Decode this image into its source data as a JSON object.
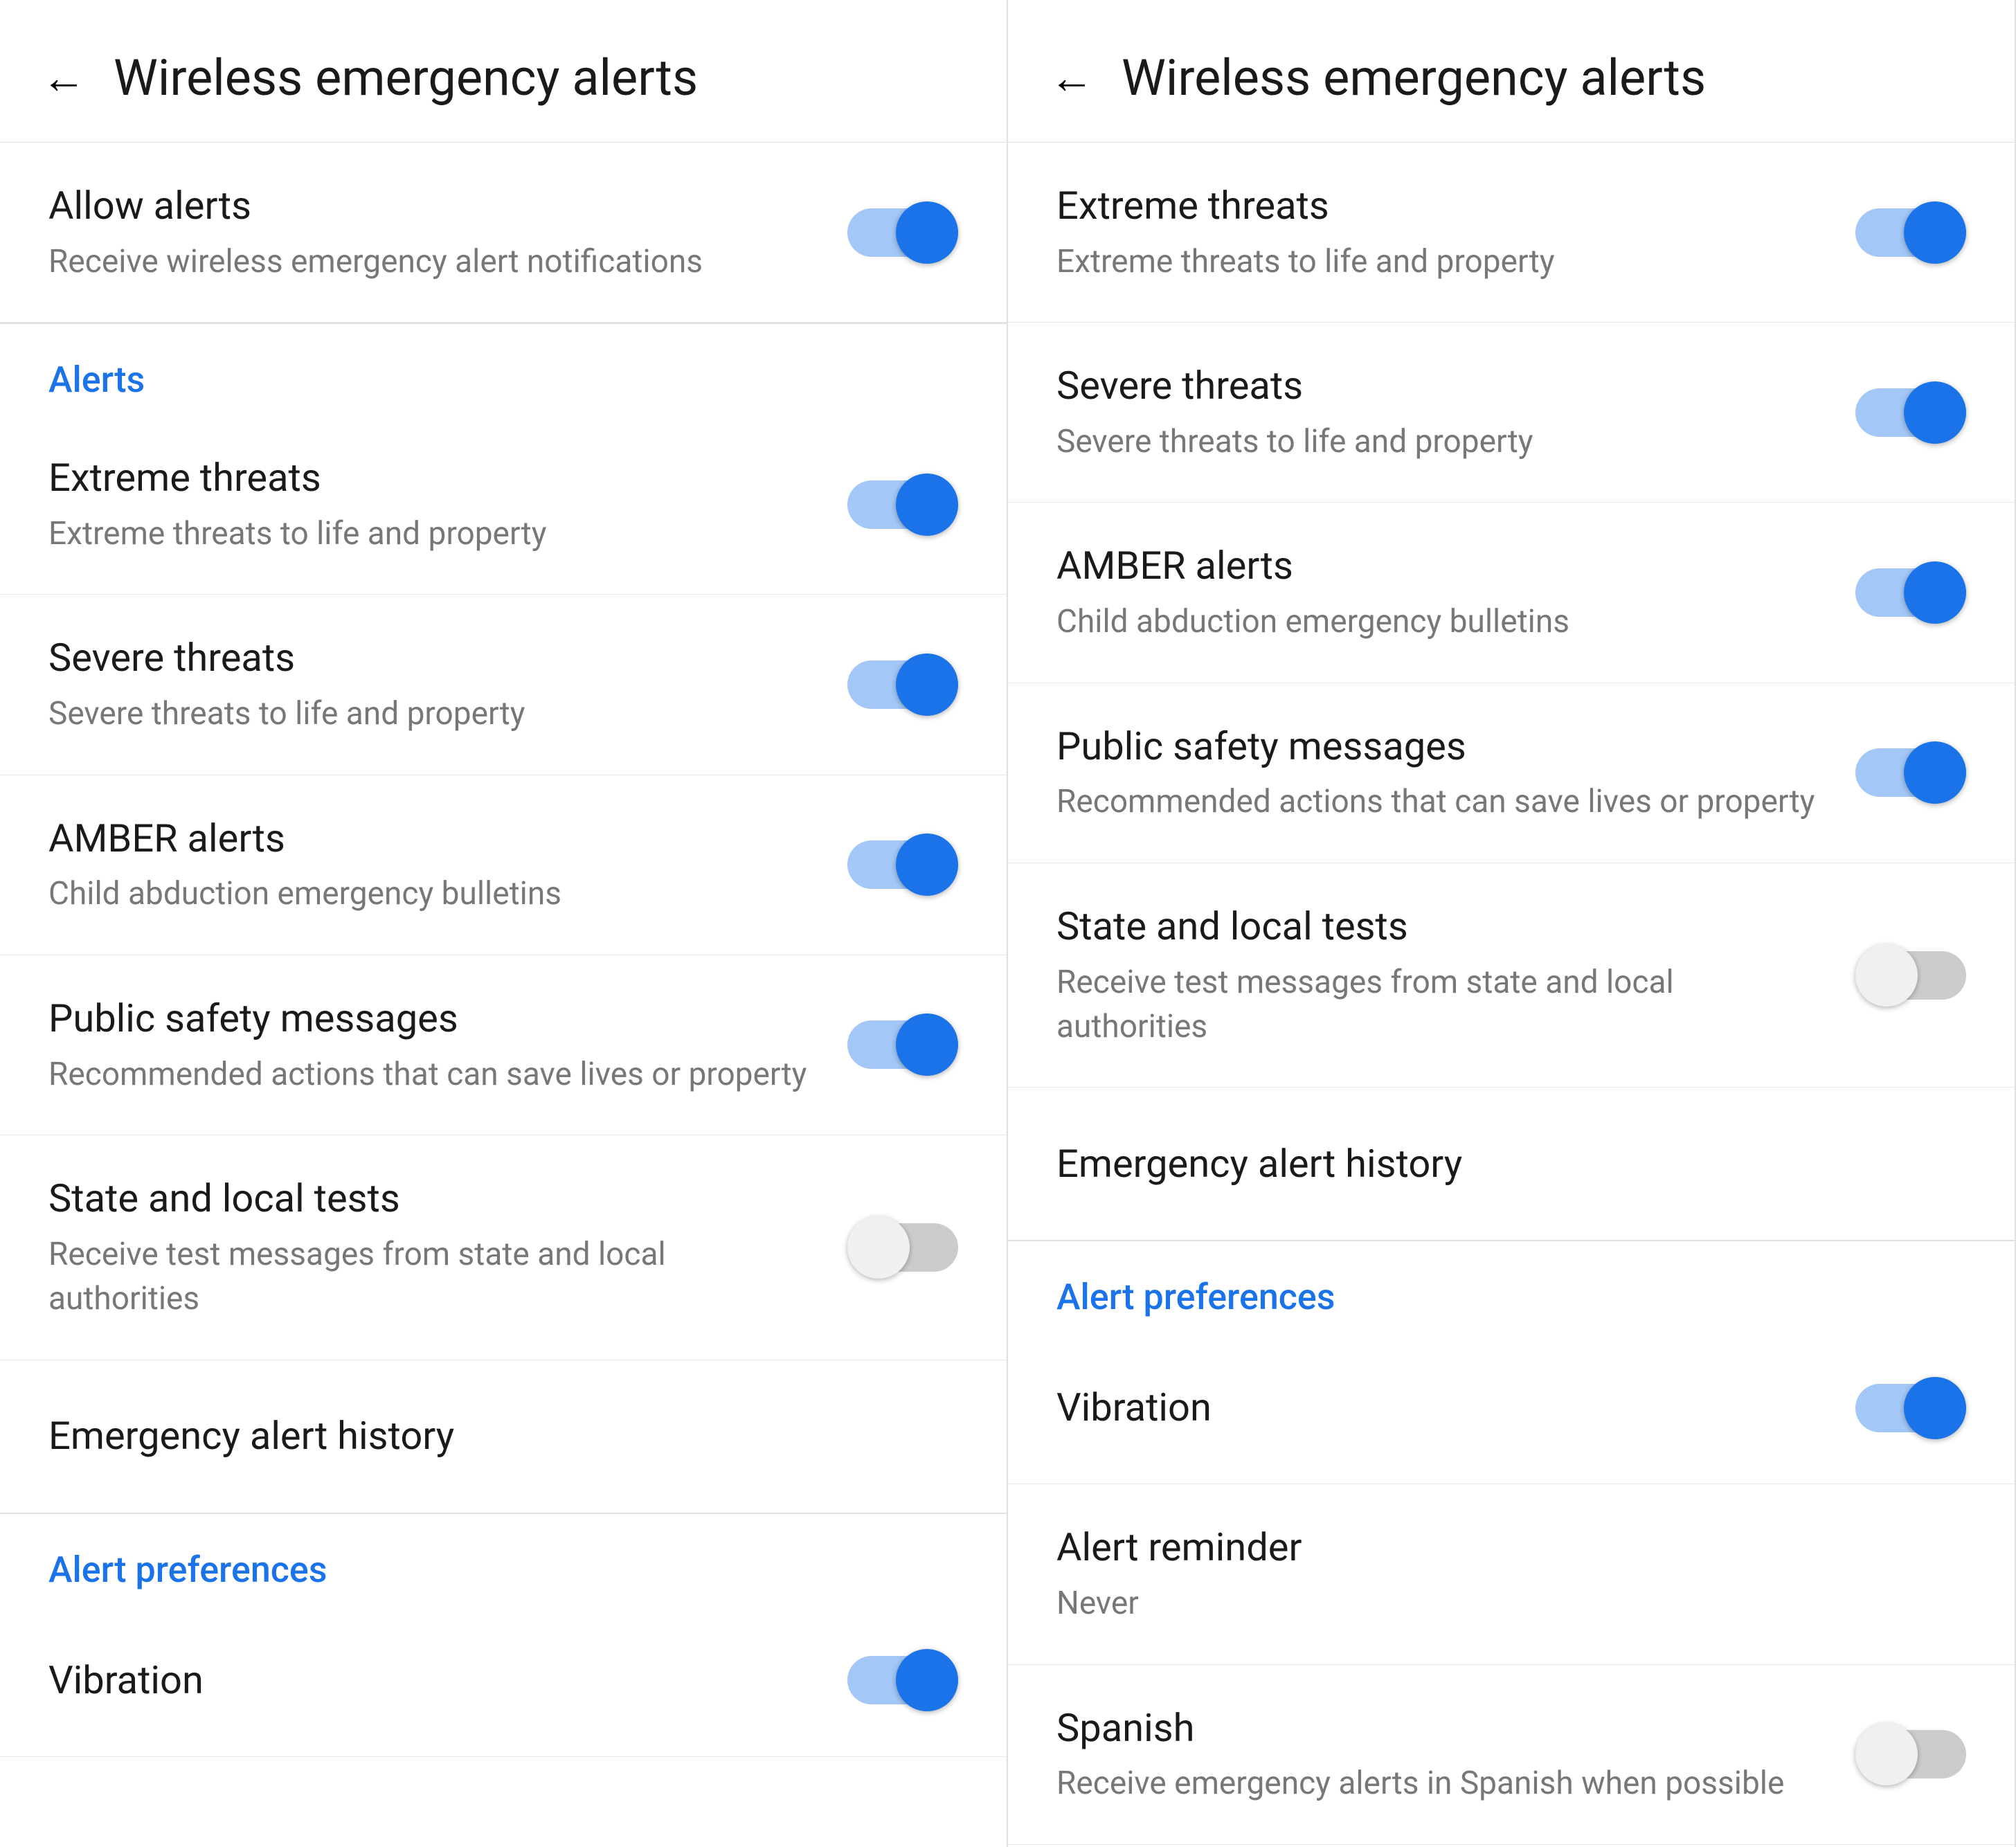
{
  "panel1": {
    "header": {
      "back_label": "←",
      "title": "Wireless emergency alerts"
    },
    "items": [
      {
        "id": "allow-alerts",
        "title": "Allow alerts",
        "subtitle": "Receive wireless emergency alert notifications",
        "toggle": true,
        "has_toggle": true
      }
    ],
    "alerts_section_label": "Alerts",
    "alert_items": [
      {
        "id": "extreme-threats",
        "title": "Extreme threats",
        "subtitle": "Extreme threats to life and property",
        "toggle": true,
        "has_toggle": true
      },
      {
        "id": "severe-threats",
        "title": "Severe threats",
        "subtitle": "Severe threats to life and property",
        "toggle": true,
        "has_toggle": true
      },
      {
        "id": "amber-alerts",
        "title": "AMBER alerts",
        "subtitle": "Child abduction emergency bulletins",
        "toggle": true,
        "has_toggle": true
      },
      {
        "id": "public-safety",
        "title": "Public safety messages",
        "subtitle": "Recommended actions that can save lives or property",
        "toggle": true,
        "has_toggle": true
      },
      {
        "id": "state-local-tests",
        "title": "State and local tests",
        "subtitle": "Receive test messages from state and local authorities",
        "toggle": false,
        "has_toggle": true
      },
      {
        "id": "emergency-history",
        "title": "Emergency alert history",
        "subtitle": "",
        "toggle": null,
        "has_toggle": false
      }
    ],
    "preferences_section_label": "Alert preferences",
    "preference_items": [
      {
        "id": "vibration",
        "title": "Vibration",
        "subtitle": "",
        "toggle": true,
        "has_toggle": true
      }
    ]
  },
  "panel2": {
    "header": {
      "back_label": "←",
      "title": "Wireless emergency alerts"
    },
    "alert_items": [
      {
        "id": "extreme-threats-2",
        "title": "Extreme threats",
        "subtitle": "Extreme threats to life and property",
        "toggle": true,
        "has_toggle": true
      },
      {
        "id": "severe-threats-2",
        "title": "Severe threats",
        "subtitle": "Severe threats to life and property",
        "toggle": true,
        "has_toggle": true
      },
      {
        "id": "amber-alerts-2",
        "title": "AMBER alerts",
        "subtitle": "Child abduction emergency bulletins",
        "toggle": true,
        "has_toggle": true
      },
      {
        "id": "public-safety-2",
        "title": "Public safety messages",
        "subtitle": "Recommended actions that can save lives or property",
        "toggle": true,
        "has_toggle": true
      },
      {
        "id": "state-local-tests-2",
        "title": "State and local tests",
        "subtitle": "Receive test messages from state and local authorities",
        "toggle": false,
        "has_toggle": true
      },
      {
        "id": "emergency-history-2",
        "title": "Emergency alert history",
        "subtitle": "",
        "toggle": null,
        "has_toggle": false
      }
    ],
    "preferences_section_label": "Alert preferences",
    "preference_items": [
      {
        "id": "vibration-2",
        "title": "Vibration",
        "subtitle": "",
        "toggle": true,
        "has_toggle": true
      },
      {
        "id": "alert-reminder",
        "title": "Alert reminder",
        "subtitle": "Never",
        "toggle": null,
        "has_toggle": false
      },
      {
        "id": "spanish",
        "title": "Spanish",
        "subtitle": "Receive emergency alerts in Spanish when possible",
        "toggle": false,
        "has_toggle": true
      }
    ]
  }
}
